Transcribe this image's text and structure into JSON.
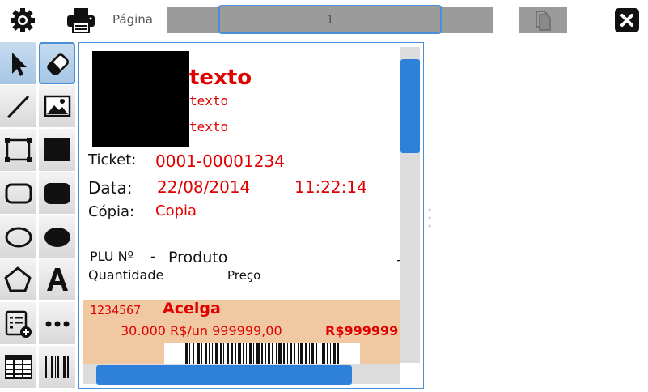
{
  "toolbar": {
    "page_label": "Página",
    "page_value": "1",
    "icons": {
      "settings": "gear-icon",
      "print": "printer-icon",
      "duplicate": "copy-pages-icon",
      "close": "close-icon"
    }
  },
  "tools": [
    {
      "name": "select-tool",
      "icon": "cursor-arrow-icon"
    },
    {
      "name": "eraser-tool",
      "icon": "eraser-icon"
    },
    {
      "name": "line-tool",
      "icon": "line-icon"
    },
    {
      "name": "image-tool",
      "icon": "image-icon"
    },
    {
      "name": "rectangle-tool",
      "icon": "rectangle-outline-icon"
    },
    {
      "name": "filled-rectangle-tool",
      "icon": "rectangle-filled-icon"
    },
    {
      "name": "rounded-rectangle-tool",
      "icon": "rounded-rectangle-outline-icon"
    },
    {
      "name": "filled-rounded-rectangle-tool",
      "icon": "rounded-rectangle-filled-icon"
    },
    {
      "name": "ellipse-tool",
      "icon": "ellipse-outline-icon"
    },
    {
      "name": "filled-ellipse-tool",
      "icon": "ellipse-filled-icon"
    },
    {
      "name": "polygon-tool",
      "icon": "pentagon-icon"
    },
    {
      "name": "text-tool",
      "icon": "text-a-icon"
    },
    {
      "name": "add-field-tool",
      "icon": "list-add-icon"
    },
    {
      "name": "more-tool",
      "icon": "ellipsis-icon"
    },
    {
      "name": "table-tool",
      "icon": "table-icon"
    },
    {
      "name": "barcode-tool",
      "icon": "barcode-icon"
    }
  ],
  "ticket": {
    "header_title": "texto",
    "header_line2": "texto",
    "header_line3": "texto",
    "ticket_label": "Ticket:",
    "ticket_value": "0001-00001234",
    "date_label": "Data:",
    "date_value": "22/08/2014",
    "time_value": "11:22:14",
    "copy_label": "Cópia:",
    "copy_value": "Copia",
    "col_plu": "PLU Nº",
    "col_dash": "-",
    "col_product": "Produto",
    "col_quantity": "Quantidade",
    "col_price": "Preço",
    "col_total": "T",
    "item_plu": "1234567",
    "item_name": "Acelga",
    "item_qty_unit": "30.000 R$/un 999999,00",
    "item_total": "R$999999"
  },
  "colors": {
    "accent": "#4a90d9",
    "scroll": "#2f80d8",
    "value_red": "#e00000",
    "band": "#f0c9a3",
    "toolbar_field": "#9b9b9b"
  }
}
